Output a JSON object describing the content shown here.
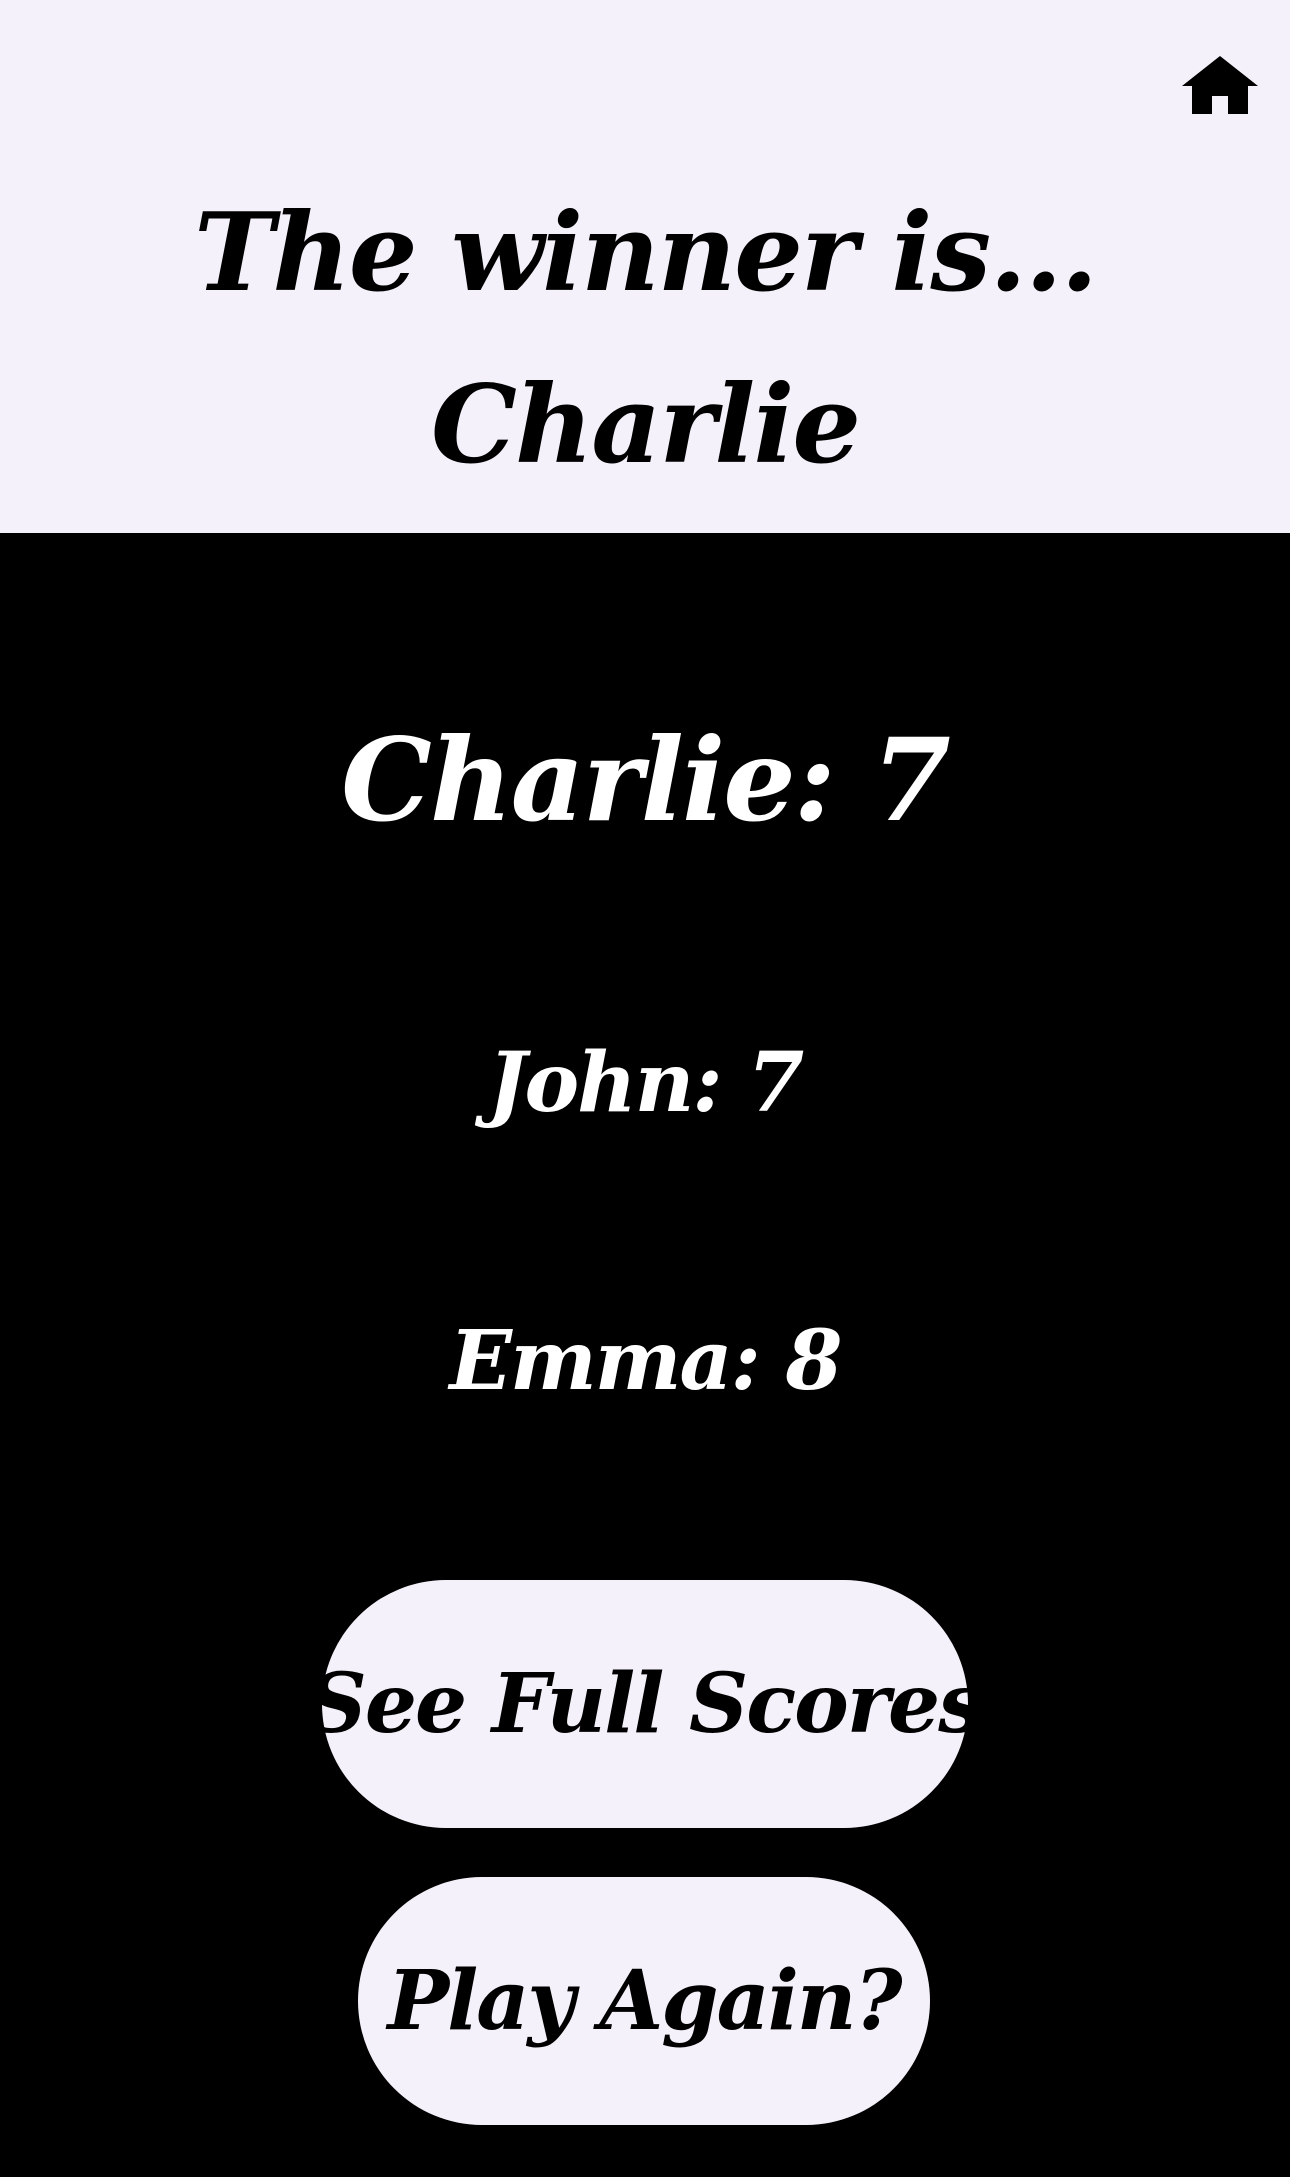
{
  "header": {
    "home_icon": "home-icon",
    "title_line1": "The winner is...",
    "title_line2": "Charlie"
  },
  "scores": [
    {
      "label": "Charlie: 7"
    },
    {
      "label": "John: 7"
    },
    {
      "label": "Emma: 8"
    }
  ],
  "actions": {
    "see_full_scores": "See Full Scores",
    "play_again": "Play Again?"
  },
  "colors": {
    "header_bg": "#f5f1fa",
    "body_bg": "#000000",
    "button_bg": "#f5f1fa"
  }
}
